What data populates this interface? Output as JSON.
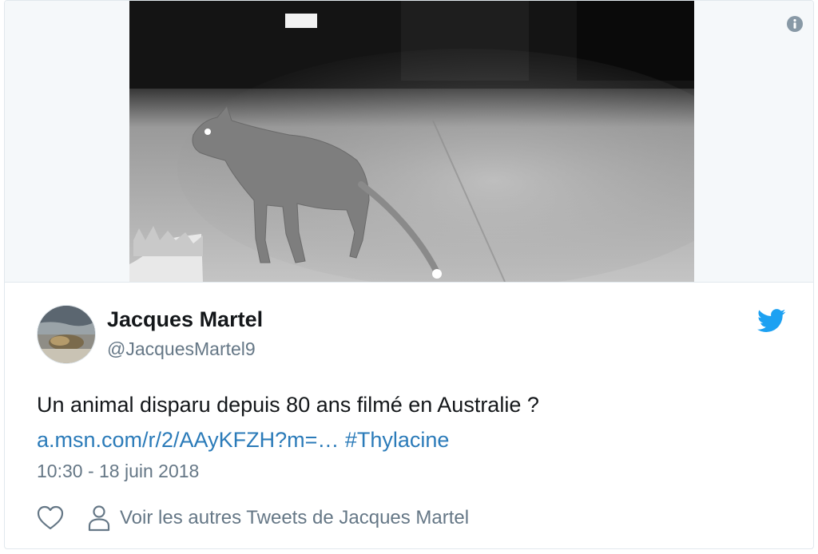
{
  "tweet": {
    "author_name": "Jacques Martel",
    "author_handle": "@JacquesMartel9",
    "text": "Un animal disparu depuis 80 ans filmé en Australie ?",
    "link_text": "a.msn.com/r/2/AAyKFZH?m=…",
    "hashtag": "#Thylacine",
    "timestamp": "10:30 - 18 juin 2018",
    "more_tweets_label": "Voir les autres Tweets de Jacques Martel"
  },
  "icons": {
    "info": "info-icon",
    "brand": "twitter-bird-icon",
    "like": "heart-icon",
    "profile": "person-icon"
  },
  "colors": {
    "text_primary": "#14171a",
    "text_secondary": "#657786",
    "link": "#2b7bb9",
    "twitter_blue": "#1da1f2",
    "border": "#e1e8ed"
  }
}
